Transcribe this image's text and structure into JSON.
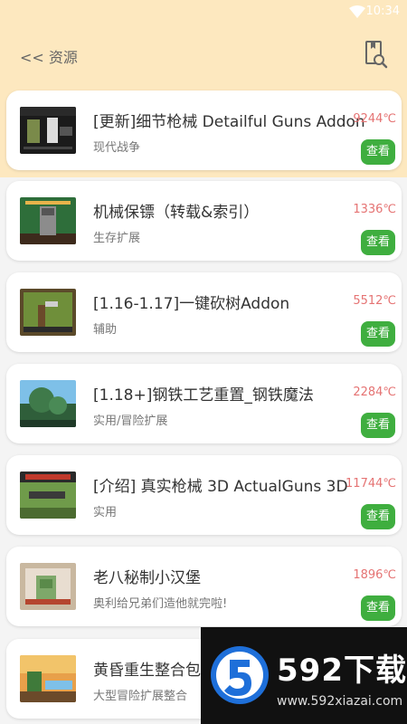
{
  "status_bar": {
    "time": "10:34"
  },
  "header": {
    "back_label": "<< 资源"
  },
  "items": [
    {
      "title": "[更新]细节枪械 Detailful Guns Addon",
      "subtitle": "现代战争",
      "temp": "9244℃",
      "button": "查看"
    },
    {
      "title": "机械保镖（转载&索引）",
      "subtitle": "生存扩展",
      "temp": "1336℃",
      "button": "查看"
    },
    {
      "title": "[1.16-1.17]一键砍树Addon",
      "subtitle": "辅助",
      "temp": "5512℃",
      "button": "查看"
    },
    {
      "title": "[1.18+]钢铁工艺重置_钢铁魔法",
      "subtitle": "实用/冒险扩展",
      "temp": "2284℃",
      "button": "查看"
    },
    {
      "title": "[介绍] 真实枪械 3D ActualGuns 3D",
      "subtitle": "实用",
      "temp": "11744℃",
      "button": "查看"
    },
    {
      "title": "老八秘制小汉堡",
      "subtitle": "奥利给兄弟们造他就完啦!",
      "temp": "1896℃",
      "button": "查看"
    },
    {
      "title": "黄昏重生整合包",
      "subtitle": "大型冒险扩展整合",
      "temp": "",
      "button": ""
    }
  ],
  "watermark": {
    "brand": "592下载",
    "url": "www.592xiazai.com"
  },
  "colors": {
    "header_bg": "#fde8bf",
    "button_green": "#3fae3f",
    "temp_red": "#e57373"
  }
}
